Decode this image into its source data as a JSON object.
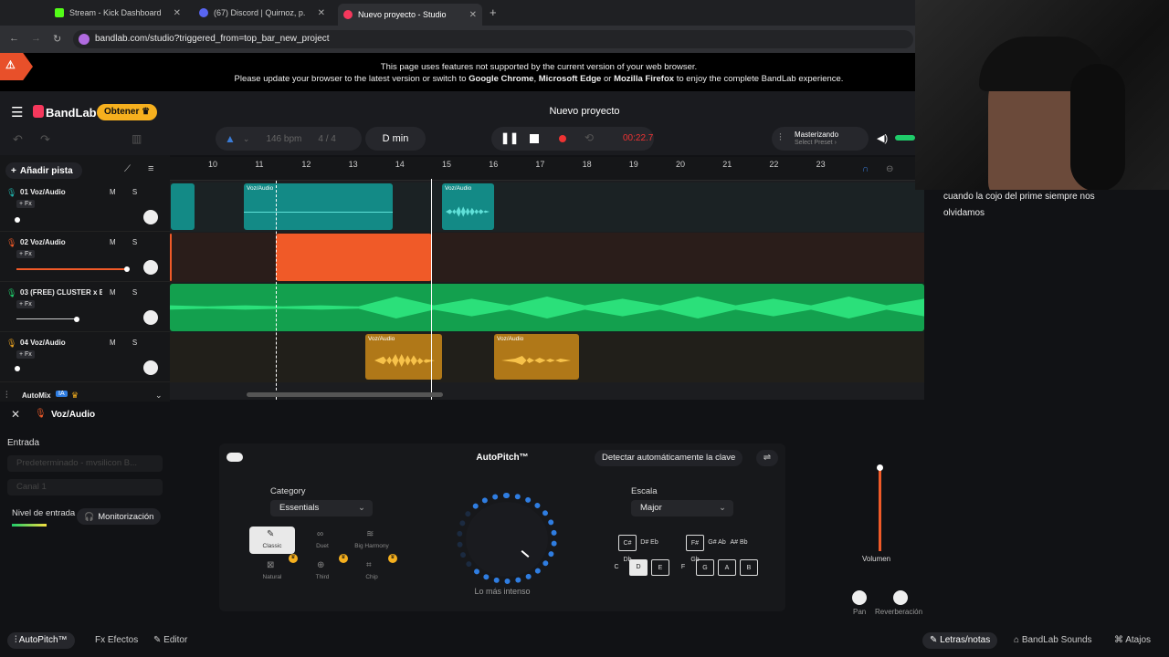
{
  "browser": {
    "tabs": [
      {
        "label": "Stream - Kick Dashboard",
        "color": "#53fc18"
      },
      {
        "label": "(67) Discord | Quirnoz, p...",
        "color": "#5865f2"
      },
      {
        "label": "Nuevo proyecto - Studio",
        "color": "#f5385c"
      }
    ],
    "url": "bandlab.com/studio?triggered_from=top_bar_new_project"
  },
  "warning": {
    "line1": "This page uses features not supported by the current version of your web browser.",
    "line2_pre": "Please update your browser to the latest version or switch to ",
    "chrome": "Google Chrome",
    "sep1": ", ",
    "edge": "Microsoft Edge",
    "sep2": " or ",
    "firefox": "Mozilla Firefox",
    "line2_post": " to enjoy the complete BandLab experience."
  },
  "app": {
    "logo": "BandLab",
    "obtener": "Obtener",
    "project_title": "Nuevo proyecto",
    "bpm": "146",
    "bpm_unit": "bpm",
    "signature": "4 / 4",
    "key": "D min",
    "time": "00:22.7",
    "mastering_title": "Masterizando",
    "mastering_sub": "Select Preset ›",
    "add_track": "Añadir pista"
  },
  "ruler": [
    "10",
    "11",
    "12",
    "13",
    "14",
    "15",
    "16",
    "17",
    "18",
    "19",
    "20",
    "21",
    "22",
    "23"
  ],
  "tracks": [
    {
      "name": "01  Voz/Audio",
      "fx": "+ Fx",
      "ms": "M S",
      "color": "#1fb0a8"
    },
    {
      "name": "02  Voz/Audio",
      "fx": "+ Fx",
      "ms": "M S",
      "color": "#f05a28"
    },
    {
      "name": "03  (FREE) CLUSTER x E...",
      "fx": "+ Fx",
      "ms": "M S",
      "color": "#1fcc6a"
    },
    {
      "name": "04  Voz/Audio",
      "fx": "+ Fx",
      "ms": "M S",
      "color": "#e6a020"
    }
  ],
  "clip_label": "Voz/Audio",
  "automix": {
    "label": "AutoMix",
    "badge": "IA"
  },
  "panel": {
    "track": "Voz/Audio",
    "entrada": "Entrada",
    "device": "Predeterminado - mvsilicon B...",
    "channel": "Canal 1",
    "nivel": "Nivel de entrada",
    "monitor": "Monitorización"
  },
  "autopitch": {
    "title": "AutoPitch™",
    "detect": "Detectar automáticamente la clave",
    "category_label": "Category",
    "category": "Essentials",
    "presets": [
      "Classic",
      "Duet",
      "Big Harmony",
      "Natural",
      "Third",
      "Chip"
    ],
    "knob_label": "Lo más intenso",
    "scale_label": "Escala",
    "scale": "Major",
    "sharps": [
      "C# Db",
      "D# Eb",
      "F# Gb",
      "G# Ab",
      "A# Bb"
    ],
    "naturals": [
      "C",
      "D",
      "E",
      "F",
      "G",
      "A",
      "B"
    ]
  },
  "mixer": {
    "volume": "Volumen",
    "pan": "Pan",
    "reverb": "Reverberación"
  },
  "bottom": {
    "autopitch": "AutoPitch™",
    "efectos": "Efectos",
    "editor": "Editor",
    "letras": "Letras/notas",
    "sounds": "BandLab Sounds",
    "atajos": "Atajos"
  },
  "chat": "cuando la cojo del prime siempre nos olvidamos"
}
